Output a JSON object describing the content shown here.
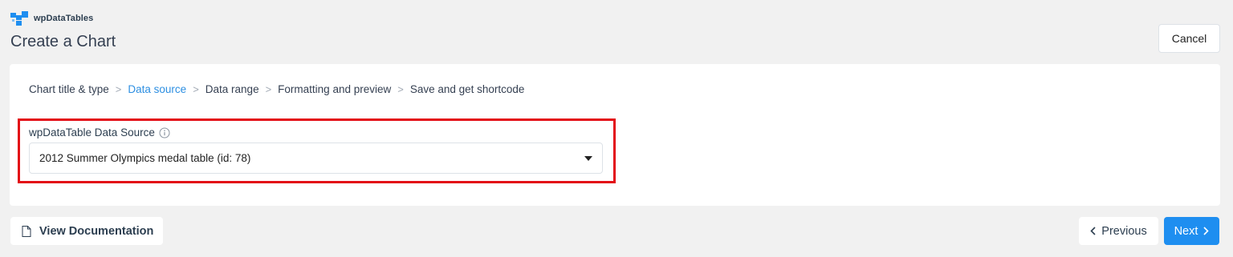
{
  "brand": {
    "name": "wpDataTables",
    "logo_icon": "wpdatatables-logo-icon",
    "logo_color": "#1e8ef0"
  },
  "header": {
    "title": "Create a Chart",
    "cancel_label": "Cancel"
  },
  "wizard": {
    "steps": [
      {
        "label": "Chart title & type",
        "active": false
      },
      {
        "label": "Data source",
        "active": true
      },
      {
        "label": "Data range",
        "active": false
      },
      {
        "label": "Formatting and preview",
        "active": false
      },
      {
        "label": "Save and get shortcode",
        "active": false
      }
    ],
    "separator": ">"
  },
  "data_source": {
    "label": "wpDataTable Data Source",
    "info_icon": "info-icon",
    "selected_value": "2012 Summer Olympics medal table (id: 78)",
    "highlight_color": "#e30d16"
  },
  "footer": {
    "documentation_label": "View Documentation",
    "previous_label": "Previous",
    "next_label": "Next",
    "accent_color": "#1e8ef0"
  }
}
